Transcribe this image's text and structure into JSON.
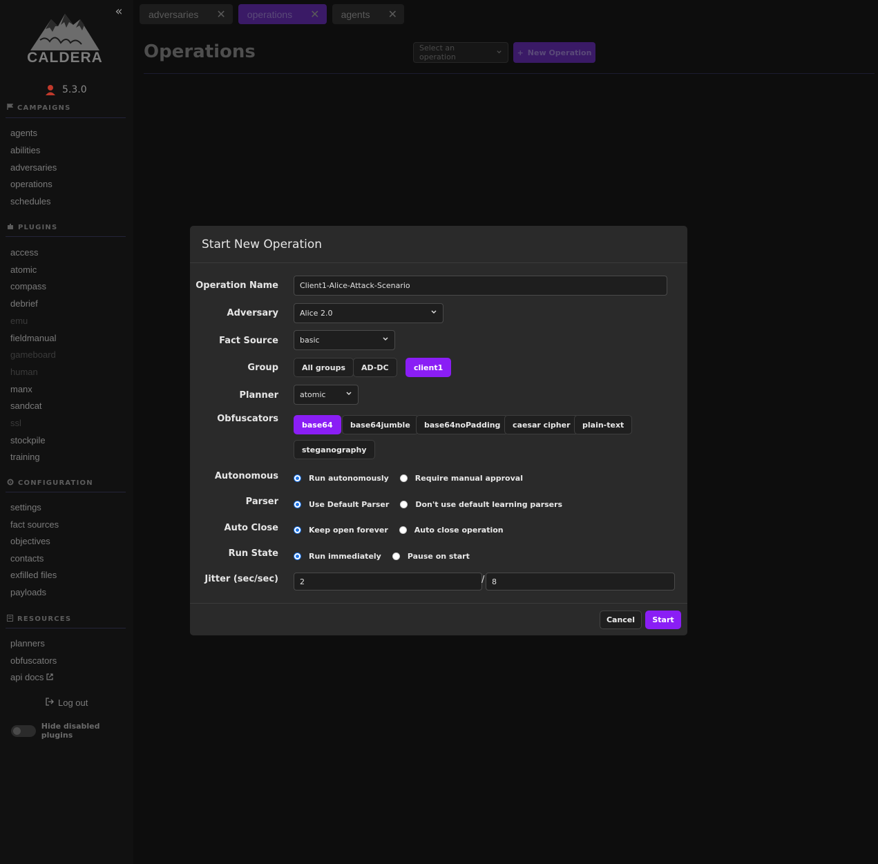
{
  "sidebar": {
    "collapse_icon": "double-chevron-left-icon",
    "logo_text": "CALDERA",
    "version": "5.3.0",
    "sections": {
      "campaigns": "CAMPAIGNS",
      "plugins": "PLUGINS",
      "configuration": "CONFIGURATION",
      "resources": "RESOURCES"
    },
    "campaigns": [
      "agents",
      "abilities",
      "adversaries",
      "operations",
      "schedules"
    ],
    "plugins": [
      {
        "label": "access",
        "disabled": false
      },
      {
        "label": "atomic",
        "disabled": false
      },
      {
        "label": "compass",
        "disabled": false
      },
      {
        "label": "debrief",
        "disabled": false
      },
      {
        "label": "emu",
        "disabled": true
      },
      {
        "label": "fieldmanual",
        "disabled": false
      },
      {
        "label": "gameboard",
        "disabled": true
      },
      {
        "label": "human",
        "disabled": true
      },
      {
        "label": "manx",
        "disabled": false
      },
      {
        "label": "sandcat",
        "disabled": false
      },
      {
        "label": "ssl",
        "disabled": true
      },
      {
        "label": "stockpile",
        "disabled": false
      },
      {
        "label": "training",
        "disabled": false
      }
    ],
    "configuration": [
      "settings",
      "fact sources",
      "objectives",
      "contacts",
      "exfilled files",
      "payloads"
    ],
    "resources": [
      "planners",
      "obfuscators",
      "api docs"
    ],
    "logout": "Log out",
    "hide_disabled": "Hide disabled plugins"
  },
  "tabs": [
    {
      "label": "adversaries",
      "active": false
    },
    {
      "label": "operations",
      "active": true
    },
    {
      "label": "agents",
      "active": false
    }
  ],
  "page": {
    "title": "Operations",
    "select_placeholder": "Select an operation",
    "new_operation": "New Operation"
  },
  "modal": {
    "title": "Start New Operation",
    "labels": {
      "operation_name": "Operation Name",
      "adversary": "Adversary",
      "fact_source": "Fact Source",
      "group": "Group",
      "planner": "Planner",
      "obfuscators": "Obfuscators",
      "autonomous": "Autonomous",
      "parser": "Parser",
      "auto_close": "Auto Close",
      "run_state": "Run State",
      "jitter": "Jitter (sec/sec)"
    },
    "operation_name": "Client1-Alice-Attack-Scenario",
    "adversary": "Alice 2.0",
    "fact_source": "basic",
    "groups": [
      {
        "label": "All groups",
        "selected": false
      },
      {
        "label": "AD-DC",
        "selected": false
      },
      {
        "label": "client1",
        "selected": true
      }
    ],
    "planner": "atomic",
    "obfuscators": [
      {
        "label": "base64",
        "selected": true
      },
      {
        "label": "base64jumble",
        "selected": false
      },
      {
        "label": "base64noPadding",
        "selected": false
      },
      {
        "label": "caesar cipher",
        "selected": false
      },
      {
        "label": "plain-text",
        "selected": false
      },
      {
        "label": "steganography",
        "selected": false
      }
    ],
    "autonomous": {
      "option_a": "Run autonomously",
      "option_b": "Require manual approval",
      "selected": "a"
    },
    "parser": {
      "option_a": "Use Default Parser",
      "option_b": "Don't use default learning parsers",
      "selected": "a"
    },
    "auto_close": {
      "option_a": "Keep open forever",
      "option_b": "Auto close operation",
      "selected": "a"
    },
    "run_state": {
      "option_a": "Run immediately",
      "option_b": "Pause on start",
      "selected": "a"
    },
    "jitter_min": "2",
    "jitter_max": "8",
    "jitter_separator": "/",
    "cancel": "Cancel",
    "start": "Start"
  },
  "colors": {
    "accent": "#8a1ef5",
    "radio_selected": "#1a73e8",
    "modal_bg": "#2a2a2a",
    "page_bg": "#0d0d0d"
  }
}
